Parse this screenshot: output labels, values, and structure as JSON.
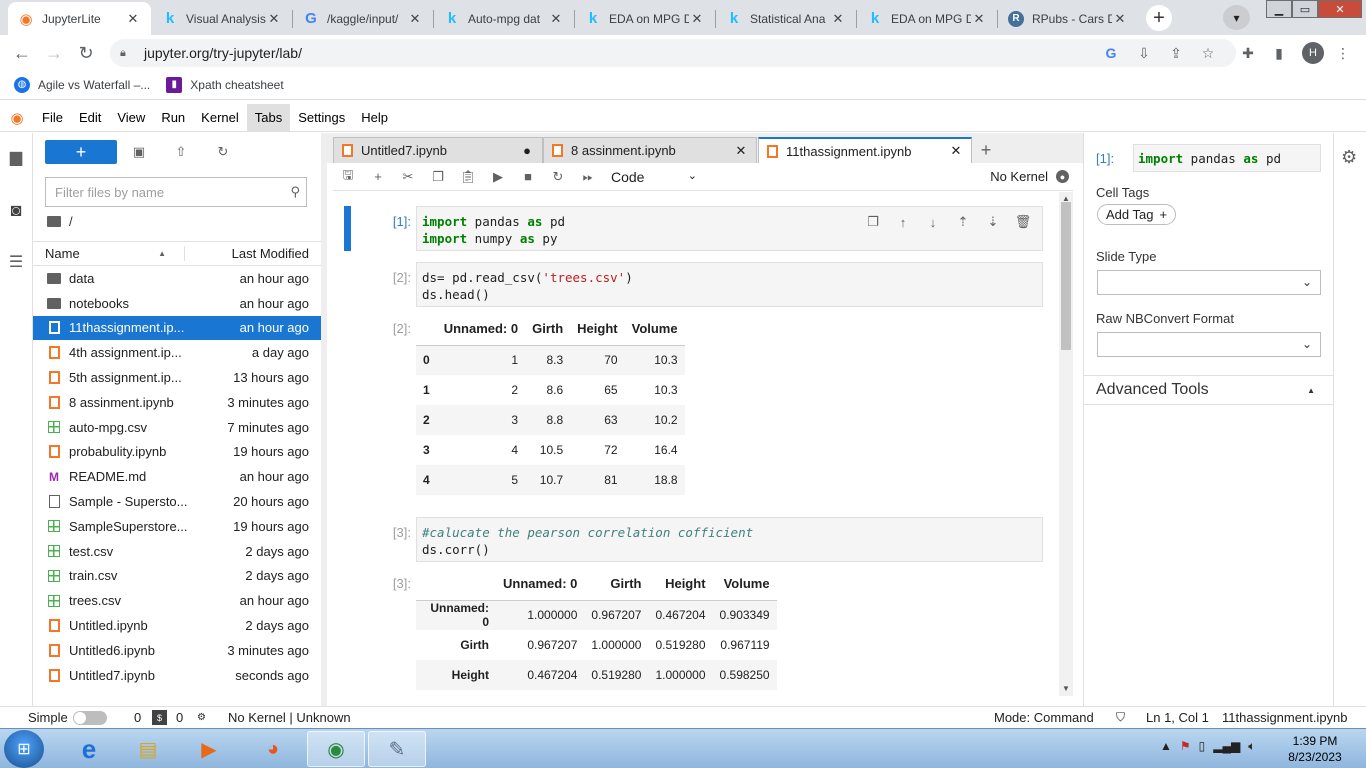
{
  "browser": {
    "tabs": [
      {
        "label": "JupyterLite",
        "active": true,
        "icon": "jupyter-icon"
      },
      {
        "label": "Visual Analysis",
        "icon": "kaggle-icon"
      },
      {
        "label": "/kaggle/input/",
        "icon": "google-icon"
      },
      {
        "label": "Auto-mpg dat",
        "icon": "kaggle-icon"
      },
      {
        "label": "EDA on MPG D",
        "icon": "kaggle-icon"
      },
      {
        "label": "Statistical Ana",
        "icon": "kaggle-icon"
      },
      {
        "label": "EDA on MPG D",
        "icon": "kaggle-icon"
      },
      {
        "label": "RPubs - Cars D",
        "icon": "rpubs-icon"
      }
    ],
    "url": "jupyter.org/try-jupyter/lab/",
    "profile_initial": "H",
    "bookmarks": [
      {
        "label": "Agile vs Waterfall –...",
        "icon": "globe-icon"
      },
      {
        "label": "Xpath cheatsheet",
        "icon": "bookmark-icon"
      }
    ]
  },
  "menubar": {
    "items": [
      "File",
      "Edit",
      "View",
      "Run",
      "Kernel",
      "Tabs",
      "Settings",
      "Help"
    ],
    "active": "Tabs"
  },
  "filebrowser": {
    "filter_placeholder": "Filter files by name",
    "breadcrumb": "/",
    "col_name": "Name",
    "col_modified": "Last Modified",
    "files": [
      {
        "name": "data",
        "modified": "an hour ago",
        "type": "folder"
      },
      {
        "name": "notebooks",
        "modified": "an hour ago",
        "type": "folder"
      },
      {
        "name": "11thassignment.ip...",
        "modified": "an hour ago",
        "type": "notebook",
        "selected": true
      },
      {
        "name": "4th assignment.ip...",
        "modified": "a day ago",
        "type": "notebook"
      },
      {
        "name": "5th assignment.ip...",
        "modified": "13 hours ago",
        "type": "notebook"
      },
      {
        "name": "8 assinment.ipynb",
        "modified": "3 minutes ago",
        "type": "notebook"
      },
      {
        "name": "auto-mpg.csv",
        "modified": "7 minutes ago",
        "type": "csv"
      },
      {
        "name": "probabulity.ipynb",
        "modified": "19 hours ago",
        "type": "notebook"
      },
      {
        "name": "README.md",
        "modified": "an hour ago",
        "type": "markdown"
      },
      {
        "name": "Sample - Supersto...",
        "modified": "20 hours ago",
        "type": "file"
      },
      {
        "name": "SampleSuperstore...",
        "modified": "19 hours ago",
        "type": "csv"
      },
      {
        "name": "test.csv",
        "modified": "2 days ago",
        "type": "csv"
      },
      {
        "name": "train.csv",
        "modified": "2 days ago",
        "type": "csv"
      },
      {
        "name": "trees.csv",
        "modified": "an hour ago",
        "type": "csv"
      },
      {
        "name": "Untitled.ipynb",
        "modified": "2 days ago",
        "type": "notebook"
      },
      {
        "name": "Untitled6.ipynb",
        "modified": "3 minutes ago",
        "type": "notebook"
      },
      {
        "name": "Untitled7.ipynb",
        "modified": "seconds ago",
        "type": "notebook"
      }
    ]
  },
  "notebook": {
    "tabs": [
      {
        "label": "Untitled7.ipynb",
        "close": "●"
      },
      {
        "label": "8 assinment.ipynb",
        "close": "✕"
      },
      {
        "label": "11thassignment.ipynb",
        "close": "✕",
        "active": true
      }
    ],
    "cell_type": "Code",
    "kernel_status": "No Kernel",
    "cells": {
      "c1_prompt": "[1]:",
      "c2_prompt": "[2]:",
      "o2_prompt": "[2]:",
      "c3_prompt": "[3]:",
      "o3_prompt": "[3]:"
    },
    "head_table": {
      "columns": [
        "",
        "Unnamed: 0",
        "Girth",
        "Height",
        "Volume"
      ],
      "rows": [
        [
          "0",
          "1",
          "8.3",
          "70",
          "10.3"
        ],
        [
          "1",
          "2",
          "8.6",
          "65",
          "10.3"
        ],
        [
          "2",
          "3",
          "8.8",
          "63",
          "10.2"
        ],
        [
          "3",
          "4",
          "10.5",
          "72",
          "16.4"
        ],
        [
          "4",
          "5",
          "10.7",
          "81",
          "18.8"
        ]
      ]
    },
    "corr_table": {
      "columns": [
        "",
        "Unnamed: 0",
        "Girth",
        "Height",
        "Volume"
      ],
      "rows": [
        [
          "Unnamed: 0",
          "1.000000",
          "0.967207",
          "0.467204",
          "0.903349"
        ],
        [
          "Girth",
          "0.967207",
          "1.000000",
          "0.519280",
          "0.967119"
        ],
        [
          "Height",
          "0.467204",
          "0.519280",
          "1.000000",
          "0.598250"
        ]
      ]
    }
  },
  "inspector": {
    "prompt": "[1]:",
    "cell_tags_label": "Cell Tags",
    "add_tag": "Add Tag",
    "slide_type_label": "Slide Type",
    "raw_format_label": "Raw NBConvert Format",
    "advanced_tools": "Advanced Tools"
  },
  "statusbar": {
    "simple": "Simple",
    "count_a": "0",
    "count_b": "0",
    "kernel": "No Kernel | Unknown",
    "mode": "Mode: Command",
    "position": "Ln 1, Col 1",
    "filename": "11thassignment.ipynb"
  },
  "taskbar": {
    "time": "1:39 PM",
    "date": "8/23/2023"
  },
  "colors": {
    "accent": "#1976d2",
    "notebook_orange": "#f37726",
    "csv_green": "#4caf50"
  }
}
